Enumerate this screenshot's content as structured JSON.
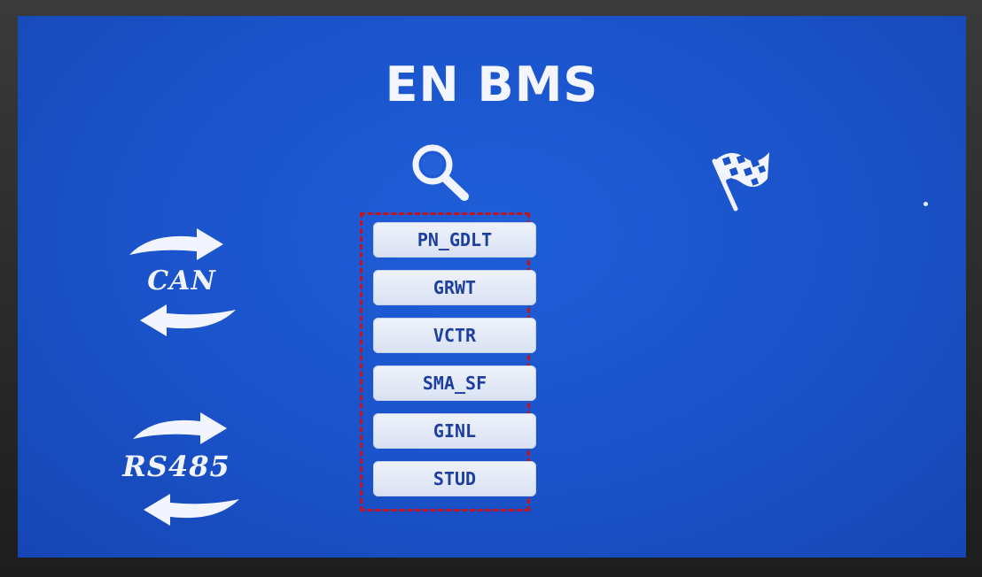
{
  "screen": {
    "title": "EN BMS"
  },
  "icons": {
    "search": "search-icon",
    "finish": "checkered-flag-icon"
  },
  "bus": {
    "can_label": "CAN",
    "rs485_label": "RS485"
  },
  "protocol_list": {
    "items": [
      {
        "label": "PN_GDLT"
      },
      {
        "label": "GRWT"
      },
      {
        "label": "VCTR"
      },
      {
        "label": "SMA_SF"
      },
      {
        "label": "GINL"
      },
      {
        "label": "STUD"
      }
    ]
  },
  "colors": {
    "screen_blue": "#1a52c9",
    "highlight_dash": "#c4131d",
    "button_text": "#1f3f9e"
  }
}
